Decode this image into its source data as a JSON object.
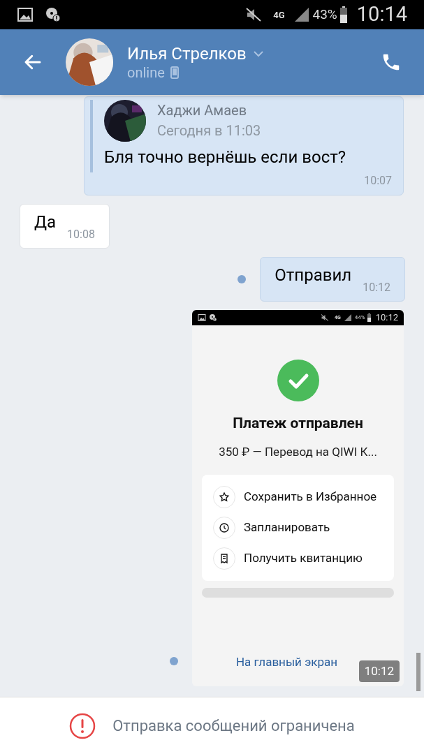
{
  "status_bar": {
    "network": "4G",
    "battery": "43%",
    "time": "10:14"
  },
  "header": {
    "name": "Илья Стрелков",
    "status": "online"
  },
  "messages": [
    {
      "kind": "forward",
      "outgoing": true,
      "unread": false,
      "quote": {
        "author": "Хаджи Амаев",
        "date": "Сегодня в 11:03"
      },
      "text": "Бля точно вернёшь если вост?",
      "time": "10:07"
    },
    {
      "kind": "text",
      "outgoing": false,
      "unread": false,
      "text": "Да",
      "time": "10:08"
    },
    {
      "kind": "text",
      "outgoing": true,
      "unread": true,
      "text": "Отправил",
      "time": "10:12"
    },
    {
      "kind": "screenshot",
      "outgoing": true,
      "unread": true,
      "time": "10:12",
      "screenshot": {
        "status_bar": {
          "network": "4G",
          "battery": "44%",
          "time": "10:12"
        },
        "title": "Платеж отправлен",
        "subtitle": "350 ₽ — Перевод на QIWI К...",
        "actions": [
          {
            "kind": "star",
            "label": "Сохранить в Избранное"
          },
          {
            "kind": "clock",
            "label": "Запланировать"
          },
          {
            "kind": "receipt",
            "label": "Получить квитанцию"
          }
        ],
        "link": "На главный экран"
      }
    }
  ],
  "notice": "Отправка сообщений ограничена"
}
